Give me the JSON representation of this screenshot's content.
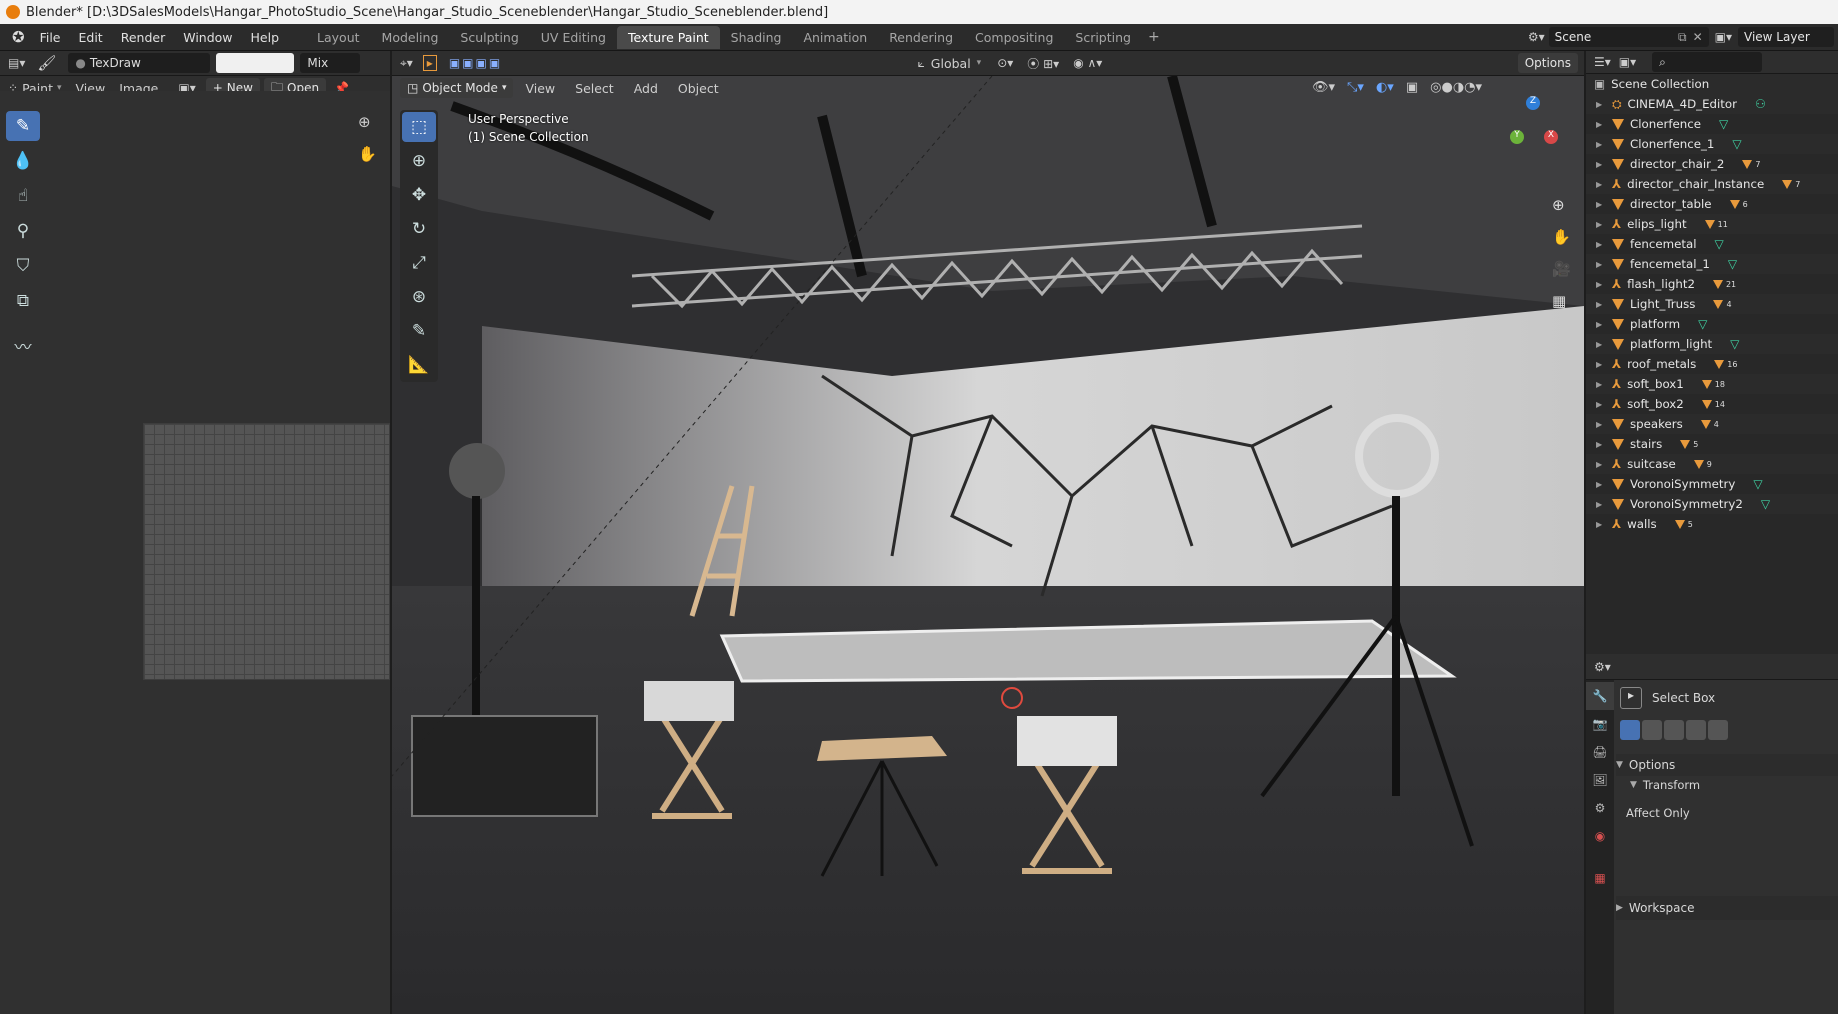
{
  "window": {
    "title": "Blender* [D:\\3DSalesModels\\Hangar_PhotoStudio_Scene\\Hangar_Studio_Sceneblender\\Hangar_Studio_Sceneblender.blend]"
  },
  "menu": [
    "File",
    "Edit",
    "Render",
    "Window",
    "Help"
  ],
  "workspaces": [
    {
      "label": "Layout"
    },
    {
      "label": "Modeling"
    },
    {
      "label": "Sculpting"
    },
    {
      "label": "UV Editing"
    },
    {
      "label": "Texture Paint",
      "active": true
    },
    {
      "label": "Shading"
    },
    {
      "label": "Animation"
    },
    {
      "label": "Rendering"
    },
    {
      "label": "Compositing"
    },
    {
      "label": "Scripting"
    }
  ],
  "scene": {
    "name": "Scene",
    "view_layer": "View Layer"
  },
  "image_editor": {
    "brush_name": "TexDraw",
    "blend_mode": "Mix",
    "mode": "Paint",
    "menus": [
      "View",
      "Image"
    ],
    "new_label": "New",
    "open_label": "Open"
  },
  "viewport": {
    "mode": "Object Mode",
    "menus": [
      "View",
      "Select",
      "Add",
      "Object"
    ],
    "orientation": "Global",
    "options_label": "Options",
    "overlay_line1": "User Perspective",
    "overlay_line2": "(1) Scene Collection",
    "axes": [
      "X",
      "Y",
      "Z"
    ]
  },
  "outliner": {
    "root": "Scene Collection",
    "items": [
      {
        "name": "CINEMA_4D_Editor",
        "type": "collection",
        "badge": ""
      },
      {
        "name": "Clonerfence",
        "type": "mesh",
        "badge": ""
      },
      {
        "name": "Clonerfence_1",
        "type": "mesh",
        "badge": ""
      },
      {
        "name": "director_chair_2",
        "type": "mesh",
        "badge": "7"
      },
      {
        "name": "director_chair_Instance",
        "type": "empty",
        "badge": "7"
      },
      {
        "name": "director_table",
        "type": "mesh",
        "badge": "6"
      },
      {
        "name": "elips_light",
        "type": "empty",
        "badge": "11"
      },
      {
        "name": "fencemetal",
        "type": "mesh",
        "badge": ""
      },
      {
        "name": "fencemetal_1",
        "type": "mesh",
        "badge": ""
      },
      {
        "name": "flash_light2",
        "type": "empty",
        "badge": "21"
      },
      {
        "name": "Light_Truss",
        "type": "mesh",
        "badge": "4"
      },
      {
        "name": "platform",
        "type": "mesh",
        "badge": ""
      },
      {
        "name": "platform_light",
        "type": "mesh",
        "badge": ""
      },
      {
        "name": "roof_metals",
        "type": "empty",
        "badge": "16"
      },
      {
        "name": "soft_box1",
        "type": "empty",
        "badge": "18"
      },
      {
        "name": "soft_box2",
        "type": "empty",
        "badge": "14"
      },
      {
        "name": "speakers",
        "type": "mesh",
        "badge": "4"
      },
      {
        "name": "stairs",
        "type": "mesh",
        "badge": "5"
      },
      {
        "name": "suitcase",
        "type": "empty",
        "badge": "9"
      },
      {
        "name": "VoronoiSymmetry",
        "type": "mesh",
        "badge": ""
      },
      {
        "name": "VoronoiSymmetry2",
        "type": "mesh",
        "badge": ""
      },
      {
        "name": "walls",
        "type": "empty",
        "badge": "5"
      }
    ]
  },
  "properties": {
    "tool_name": "Select Box",
    "section_options": "Options",
    "section_transform": "Transform",
    "affect_only": "Affect Only",
    "section_workspace": "Workspace"
  },
  "colors": {
    "accent": "#4772b3",
    "object_orange": "#e89a3c",
    "mesh_green": "#3fd1a2",
    "header": "#2b2b2b"
  }
}
